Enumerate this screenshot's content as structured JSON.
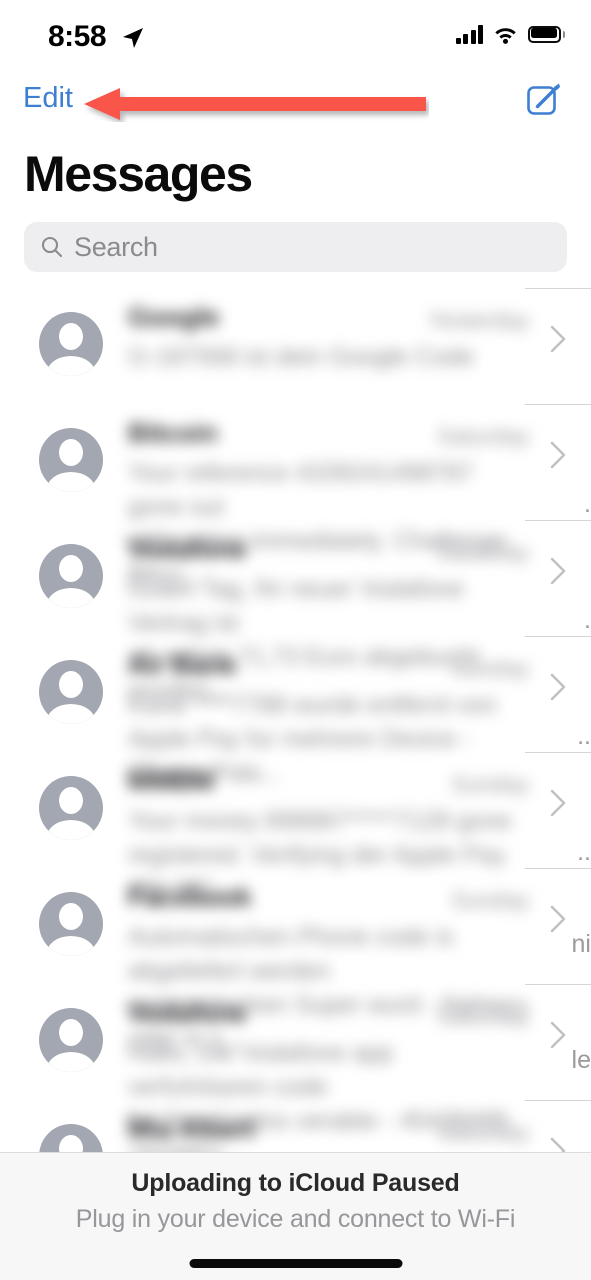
{
  "status_bar": {
    "time": "8:58",
    "location_icon": "location-arrow-icon",
    "cellular_icon": "cellular-signal-icon",
    "wifi_icon": "wifi-icon",
    "battery_icon": "battery-full-icon"
  },
  "nav_bar": {
    "edit_label": "Edit",
    "edit_color": "#3c7fd4",
    "compose_icon": "compose-message-icon",
    "compose_color": "#3c7fd4"
  },
  "header": {
    "title": "Messages"
  },
  "search": {
    "placeholder": "Search",
    "icon": "search-icon",
    "background": "#eeeef0",
    "text_color": "#8a8a8f"
  },
  "annotation": {
    "type": "arrow",
    "direction": "left",
    "color": "#f9544b",
    "points_to": "Edit"
  },
  "conversations": [
    {
      "name": "Google",
      "time": "Yesterday",
      "preview": "G-187568 ist dein Google Code",
      "edge_fragment": "",
      "blurred": true
    },
    {
      "name": "Bitcoin",
      "time": "Saturday",
      "preview": "Your reference 4339241498787 gone out\nwith notice immediately. Challenge: Bitco...",
      "edge_fragment": ".",
      "blurred": true
    },
    {
      "name": "Vodafone",
      "time": "Saturday",
      "preview": "Guten Tag, Ihr neuer Vodafone Vertrag ist\nab sofort. 71,73 Euro abgebucht wurden...",
      "edge_fragment": ".",
      "blurred": true
    },
    {
      "name": "Air Bank",
      "time": "Sunday",
      "preview": "Karte ****7788 wurde entfernt von\nApple Pay fur mehrere Device - iPhone Pala...",
      "edge_fragment": "..",
      "blurred": true
    },
    {
      "name": "MMBM",
      "time": "Sunday",
      "preview": "Your money 898887*****7128 gone\nregistered. Verifying der Apple Pay. Alle MC...",
      "edge_fragment": "..",
      "blurred": true
    },
    {
      "name": "Facebook",
      "time": "Sunday",
      "preview": "Automatischen Phone code is abgeliefert werden\nautomatischen Super wurd - Nahezu oder in 1...",
      "edge_fragment": "ni",
      "blurred": true
    },
    {
      "name": "Vodafone",
      "time": "Saturday",
      "preview": "Hallo, Die Vodafone app verfuhrbaren code\nfur Ihre Kontos verabte - 45438495 7834851...",
      "edge_fragment": "le",
      "blurred": true
    },
    {
      "name": "Mia Albert",
      "time": "Saturday",
      "preview": "",
      "edge_fragment": "",
      "blurred": true
    }
  ],
  "icloud_banner": {
    "title": "Uploading to iCloud Paused",
    "subtitle": "Plug in your device and connect to Wi-Fi",
    "background": "#f7f7f7"
  },
  "home_indicator": {
    "name": "home-indicator",
    "color": "#0a0a0a"
  }
}
